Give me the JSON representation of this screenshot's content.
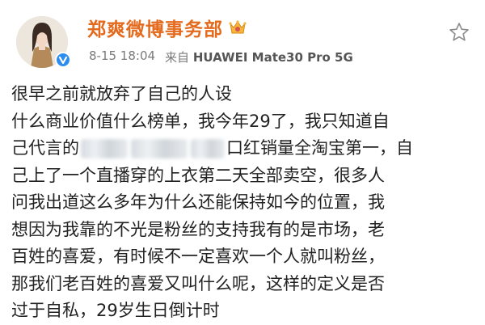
{
  "post": {
    "author": {
      "name": "郑爽微博事务部",
      "avatar_alt": "avatar"
    },
    "meta": {
      "timestamp": "8-15 18:04",
      "source_prefix": "来自",
      "device": "HUAWEI Mate30 Pro 5G"
    },
    "content_lines": [
      "很早之前就放弃了自己的人设",
      "什么商业价值什么榜单，我今年29了，我只知道自",
      "口红销量全淘宝第一，自",
      "己上了一个直播穿的上衣第二天全部卖空，很多人",
      "问我出道这么多年为什么还能保持如今的位置，我",
      "想因为我靠的不光是粉丝的支持我有的是市场，老",
      "百姓的喜爱，有时候不一定喜欢一个人就叫粉丝，",
      "那我们老百姓的喜爱又叫什么呢，这样的定义是否",
      "过于自私，29岁生日倒计时"
    ],
    "redacted_prefix": "己代言的"
  },
  "colors": {
    "username": "#e46b1e",
    "verified": "#2d8cf0",
    "text": "#222222",
    "meta": "#7a7a7a"
  }
}
